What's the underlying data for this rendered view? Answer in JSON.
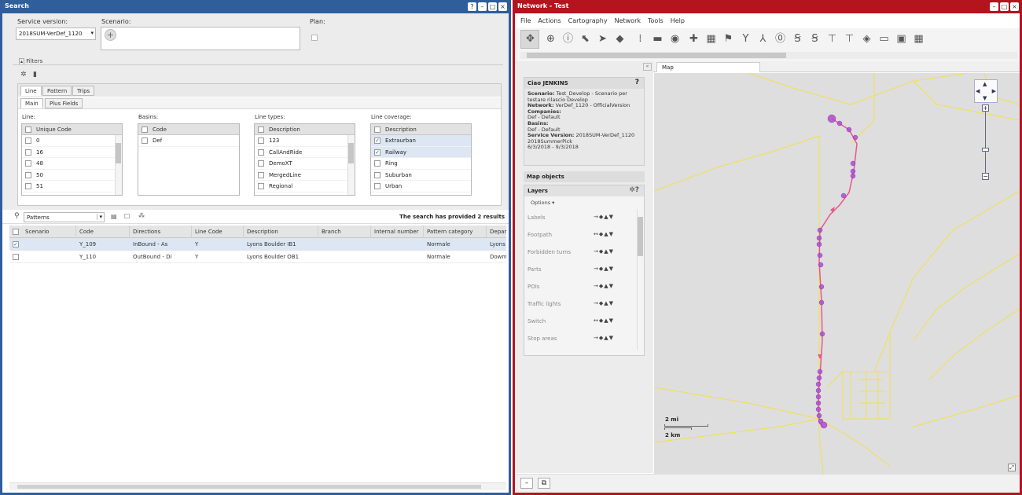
{
  "left_window": {
    "title": "Search",
    "service_version_label": "Service version:",
    "service_version_value": "2018SUM-VerDef_1120",
    "scenario_label": "Scenario:",
    "plan_label": "Plan:",
    "filters_label": "Filters",
    "tabs": [
      "Line",
      "Pattern",
      "Trips"
    ],
    "subtabs": [
      "Main",
      "Plus Fields"
    ],
    "line": {
      "label": "Line:",
      "header": "Unique Code",
      "items": [
        "0",
        "16",
        "48",
        "50",
        "51"
      ]
    },
    "basins": {
      "label": "Basins:",
      "header": "Code",
      "items": [
        "Def"
      ]
    },
    "line_types": {
      "label": "Line types:",
      "header": "Description",
      "items": [
        "123",
        "CallAndRide",
        "DemoXT",
        "MergedLine",
        "Regional"
      ]
    },
    "line_coverage": {
      "label": "Line coverage:",
      "header": "Description",
      "items": [
        "Extraurban",
        "Railway",
        "Ring",
        "Suburban",
        "Urban"
      ],
      "checked": [
        true,
        true,
        false,
        false,
        false
      ]
    },
    "results_type": "Patterns",
    "results_summary": "The search has provided 2 results",
    "columns": [
      "Scenario",
      "Code",
      "Directions",
      "Line Code",
      "Description",
      "Branch",
      "Internal number",
      "Pattern category",
      "Depar"
    ],
    "rows": [
      {
        "scenario": "",
        "code": "Y_109",
        "directions": "InBound - As",
        "line_code": "Y",
        "description": "Lyons Boulder IB1",
        "branch": "",
        "internal": "",
        "category": "Normale",
        "depar": "Lyons",
        "checked": true
      },
      {
        "scenario": "",
        "code": "Y_110",
        "directions": "OutBound - Di",
        "line_code": "Y",
        "description": "Lyons Boulder OB1",
        "branch": "",
        "internal": "",
        "category": "Normale",
        "depar": "Downt",
        "checked": false
      }
    ]
  },
  "right_window": {
    "title": "Network - Test",
    "menu": [
      "File",
      "Actions",
      "Cartography",
      "Network",
      "Tools",
      "Help"
    ],
    "map_tab": "Map",
    "info_title": "Ciao JENKINS",
    "info_help": "?",
    "info_lines": [
      {
        "k": "Scenario:",
        "v": " Test_Develop - Scenario per testare rilascio Develop"
      },
      {
        "k": "Network:",
        "v": " VerDef_1120 - OfficialVersion"
      },
      {
        "k": "Companies:",
        "v": ""
      },
      {
        "k": "",
        "v": "Def - Default"
      },
      {
        "k": "Basins:",
        "v": ""
      },
      {
        "k": "",
        "v": "Def - Default"
      },
      {
        "k": "Service Version:",
        "v": " 2018SUM-VerDef_1120 2018SummerPick"
      },
      {
        "k": "",
        "v": "6/3/2018 - 9/3/2018"
      }
    ],
    "map_objects_label": "Map objects",
    "layers_label": "Layers",
    "options_label": "Options",
    "layers": [
      "Labels",
      "Footpath",
      "Forbidden turns",
      "Parts",
      "POIs",
      "Traffic lights",
      "Switch",
      "Stop areas"
    ],
    "scale_mi": "2 mi",
    "scale_km": "2 km"
  },
  "colors": {
    "left_frame": "#2f5e9b",
    "right_frame": "#b3141d",
    "route": "#e8578a",
    "stop": "#b04bd1",
    "roads": "#f2e04a"
  }
}
